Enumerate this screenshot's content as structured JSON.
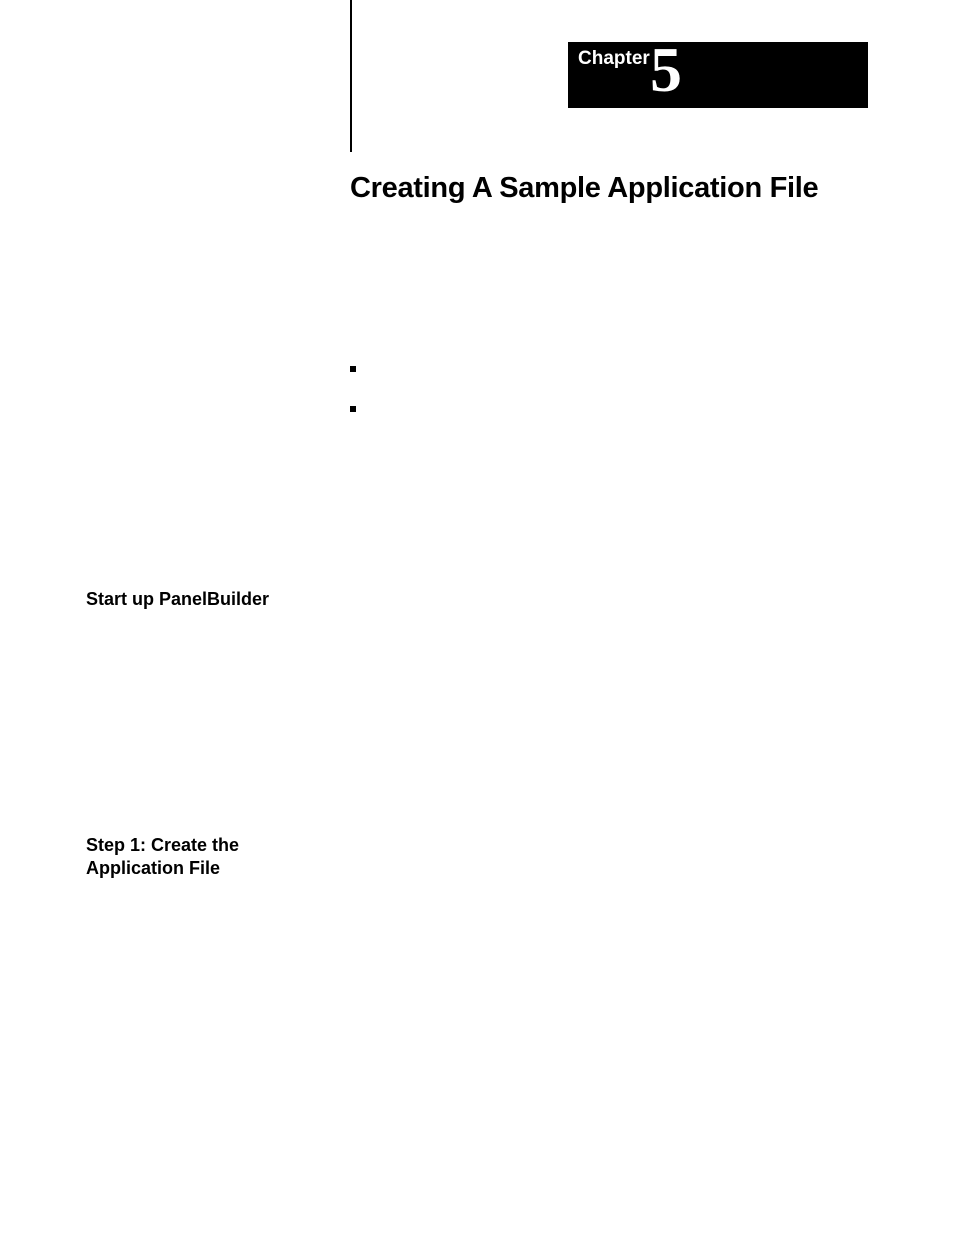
{
  "chapter": {
    "label": "Chapter",
    "number": "5"
  },
  "title": "Creating A Sample Application File",
  "bullets": {
    "items": [
      {
        "text": ""
      },
      {
        "text": ""
      }
    ]
  },
  "sideHeadings": {
    "startup": "Start up PanelBuilder",
    "step1": "Step 1: Create the Application File"
  }
}
